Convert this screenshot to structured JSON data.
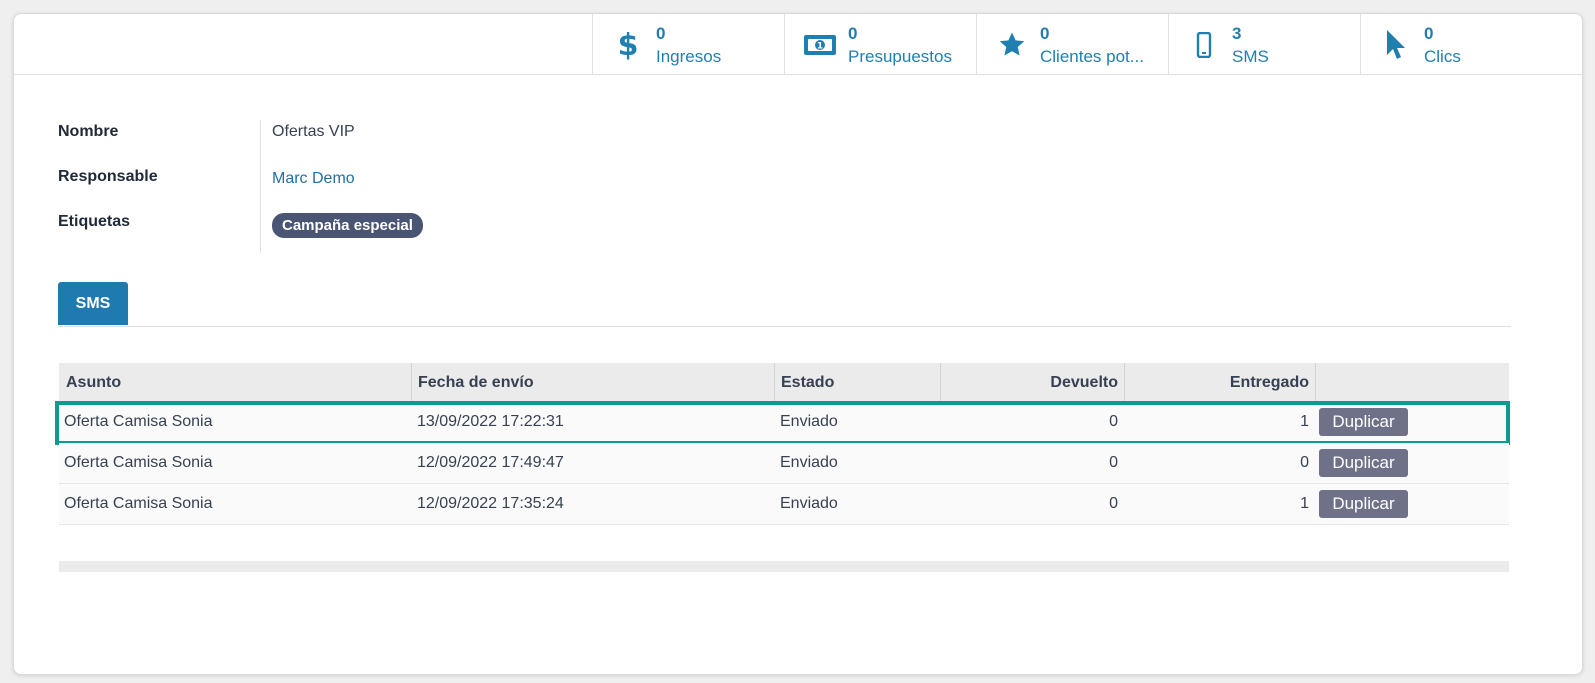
{
  "stats": [
    {
      "icon": "dollar-icon",
      "value": "0",
      "label": "Ingresos"
    },
    {
      "icon": "money-bill-icon",
      "value": "0",
      "label": "Presupuestos"
    },
    {
      "icon": "star-icon",
      "value": "0",
      "label": "Clientes pot..."
    },
    {
      "icon": "mobile-phone-icon",
      "value": "3",
      "label": "SMS"
    },
    {
      "icon": "pointer-cursor-icon",
      "value": "0",
      "label": "Clics"
    }
  ],
  "form": {
    "name_label": "Nombre",
    "name_value": "Ofertas VIP",
    "responsible_label": "Responsable",
    "responsible_value": "Marc Demo",
    "tags_label": "Etiquetas",
    "tag": "Campaña especial"
  },
  "tab": {
    "label": "SMS"
  },
  "table": {
    "headers": [
      "Asunto",
      "Fecha de envío",
      "Estado",
      "Devuelto",
      "Entregado"
    ],
    "rows": [
      {
        "subject": "Oferta Camisa Sonia",
        "date": "13/09/2022 17:22:31",
        "status": "Enviado",
        "bounced": "0",
        "delivered": "1",
        "action": "Duplicar"
      },
      {
        "subject": "Oferta Camisa Sonia",
        "date": "12/09/2022 17:49:47",
        "status": "Enviado",
        "bounced": "0",
        "delivered": "0",
        "action": "Duplicar"
      },
      {
        "subject": "Oferta Camisa Sonia",
        "date": "12/09/2022 17:35:24",
        "status": "Enviado",
        "bounced": "0",
        "delivered": "1",
        "action": "Duplicar"
      }
    ]
  },
  "colors": {
    "accent": "#1f7fb0",
    "tag": "#4a5573",
    "highlight": "#0d9b8e",
    "button": "#6e7187"
  }
}
